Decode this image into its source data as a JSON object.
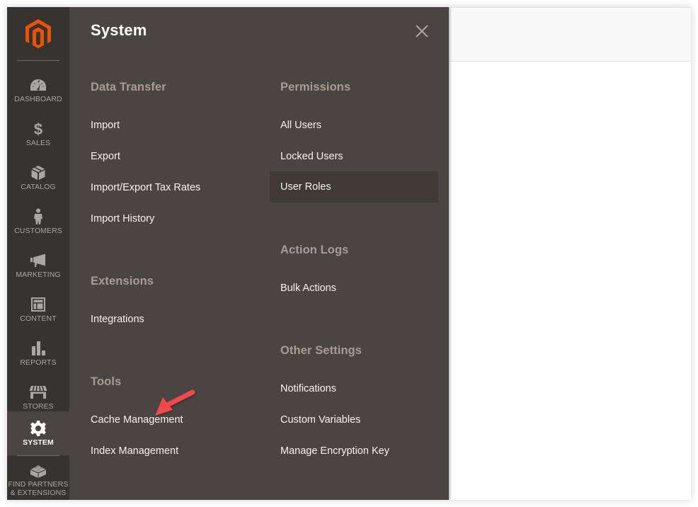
{
  "app": {
    "brand_color": "#eb5202",
    "sidebar_bg": "#373330",
    "flyout_bg": "#4a4542"
  },
  "sidebar": {
    "logo": "magento-logo-icon",
    "items": [
      {
        "label": "Dashboard",
        "icon": "dashboard-gauge-icon",
        "active": false
      },
      {
        "label": "Sales",
        "icon": "dollar-icon",
        "active": false
      },
      {
        "label": "Catalog",
        "icon": "box-icon",
        "active": false
      },
      {
        "label": "Customers",
        "icon": "person-icon",
        "active": false
      },
      {
        "label": "Marketing",
        "icon": "megaphone-icon",
        "active": false
      },
      {
        "label": "Content",
        "icon": "layout-icon",
        "active": false
      },
      {
        "label": "Reports",
        "icon": "bar-chart-icon",
        "active": false
      },
      {
        "label": "Stores",
        "icon": "storefront-icon",
        "active": false
      },
      {
        "label": "System",
        "icon": "gear-icon",
        "active": true
      },
      {
        "label_line1": "Find Partners",
        "label_line2": "& Extensions",
        "icon": "lego-brick-icon",
        "active": false
      }
    ]
  },
  "flyout": {
    "title": "System",
    "close_icon": "close-icon",
    "left_column": [
      {
        "title": "Data Transfer",
        "links": [
          "Import",
          "Export",
          "Import/Export Tax Rates",
          "Import History"
        ]
      },
      {
        "title": "Extensions",
        "links": [
          "Integrations"
        ]
      },
      {
        "title": "Tools",
        "links": [
          "Cache Management",
          "Index Management"
        ]
      }
    ],
    "right_column": [
      {
        "title": "Permissions",
        "links": [
          "All Users",
          "Locked Users",
          "User Roles"
        ],
        "hovered": "User Roles"
      },
      {
        "title": "Action Logs",
        "links": [
          "Bulk Actions"
        ]
      },
      {
        "title": "Other Settings",
        "links": [
          "Notifications",
          "Custom Variables",
          "Manage Encryption Key"
        ]
      }
    ]
  },
  "annotation": {
    "type": "arrow",
    "color": "#f04a4a",
    "points_to": "Cache Management"
  }
}
